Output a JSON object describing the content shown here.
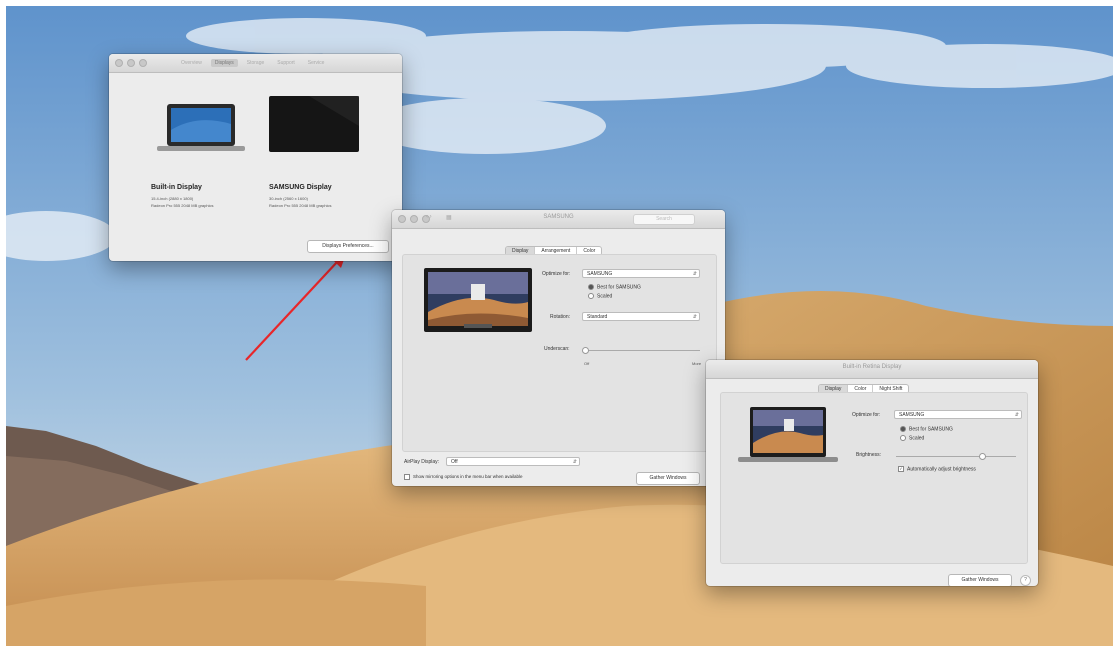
{
  "about_window": {
    "toolbar_tabs": [
      "Overview",
      "Displays",
      "Storage",
      "Support",
      "Service"
    ],
    "displays": [
      {
        "name": "Built-in Display",
        "size": "15.4-inch (2880 x 1800)",
        "graphics": "Radeon Pro 555 2048 MB graphics"
      },
      {
        "name": "SAMSUNG Display",
        "size": "30-inch (2560 x 1600)",
        "graphics": "Radeon Pro 555 2048 MB graphics"
      }
    ],
    "prefs_button": "Displays Preferences..."
  },
  "samsung_window": {
    "title": "SAMSUNG",
    "search_placeholder": "Search",
    "tabs": [
      "Display",
      "Arrangement",
      "Color"
    ],
    "optimize_label": "Optimize for:",
    "optimize_value": "SAMSUNG",
    "radio_best": "Best for SAMSUNG",
    "radio_scaled": "Scaled",
    "rotation_label": "Rotation:",
    "rotation_value": "Standard",
    "underscan_label": "Underscan:",
    "underscan_off": "Off",
    "underscan_more": "More",
    "airplay_label": "AirPlay Display:",
    "airplay_value": "Off",
    "mirroring_checkbox": "Show mirroring options in the menu bar when available",
    "gather_button": "Gather Windows",
    "help": "?"
  },
  "builtin_window": {
    "title": "Built-in Retina Display",
    "tabs": [
      "Display",
      "Color",
      "Night Shift"
    ],
    "optimize_label": "Optimize for:",
    "optimize_value": "SAMSUNG",
    "radio_best": "Best for SAMSUNG",
    "radio_scaled": "Scaled",
    "brightness_label": "Brightness:",
    "brightness_level": 0.72,
    "auto_brightness": "Automatically adjust brightness",
    "gather_button": "Gather Windows",
    "help": "?"
  },
  "colors": {
    "arrow": "#e8262a",
    "sky_top": "#6d9cd0",
    "sand": "#d8a867"
  }
}
